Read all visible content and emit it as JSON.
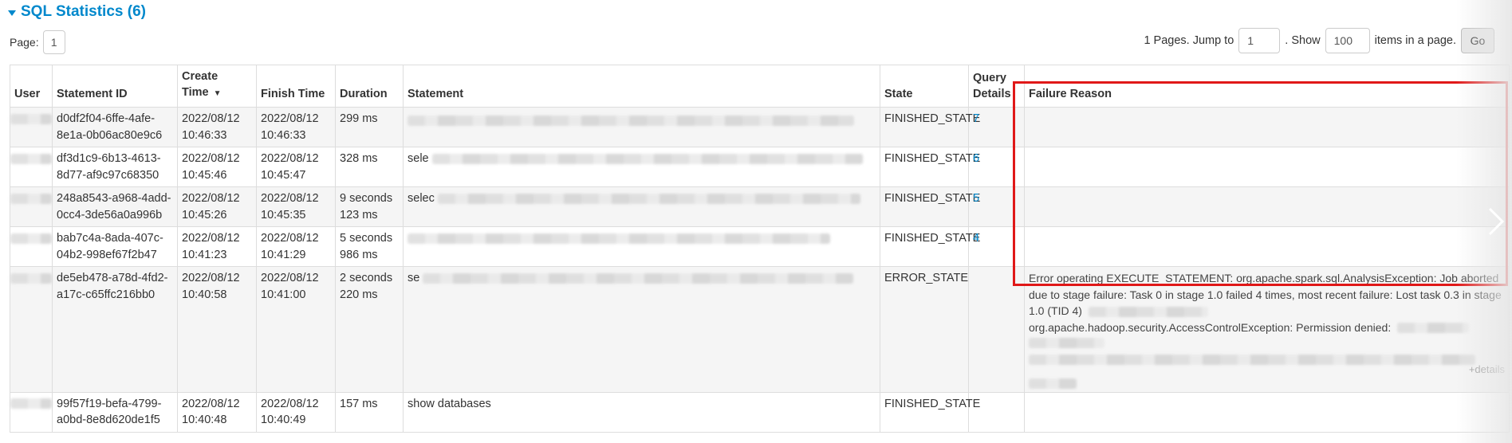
{
  "section": {
    "title": "SQL Statistics (6)"
  },
  "pager": {
    "page_label": "Page:",
    "current_page": "1",
    "pages_text": "1 Pages. Jump to",
    "jump_value": "1",
    "show_label": ". Show",
    "show_value": "100",
    "items_label": "items in a page.",
    "go_label": "Go"
  },
  "table": {
    "headers": {
      "user": "User",
      "statement_id": "Statement ID",
      "create_time": "Create Time",
      "finish_time": "Finish Time",
      "duration": "Duration",
      "statement": "Statement",
      "state": "State",
      "query_details": "Query Details",
      "failure_reason": "Failure Reason"
    },
    "rows": [
      {
        "statement_id": "d0df2f04-6ffe-4afe-8e1a-0b06ac80e9c6",
        "create_time": "2022/08/12 10:46:33",
        "finish_time": "2022/08/12 10:46:33",
        "duration": "299 ms",
        "statement": "",
        "state": "FINISHED_STATE",
        "query_details": "7",
        "failure_reason": ""
      },
      {
        "statement_id": "df3d1c9-6b13-4613-8d77-af9c97c68350",
        "create_time": "2022/08/12 10:45:46",
        "finish_time": "2022/08/12 10:45:47",
        "duration": "328 ms",
        "statement": "sele",
        "state": "FINISHED_STATE",
        "query_details": "6",
        "failure_reason": ""
      },
      {
        "statement_id": "248a8543-a968-4add-0cc4-3de56a0a996b",
        "create_time": "2022/08/12 10:45:26",
        "finish_time": "2022/08/12 10:45:35",
        "duration": "9 seconds 123 ms",
        "statement": "selec",
        "state": "FINISHED_STATE",
        "query_details": "5",
        "failure_reason": ""
      },
      {
        "statement_id": "bab7c4a-8ada-407c-04b2-998ef67f2b47",
        "create_time": "2022/08/12 10:41:23",
        "finish_time": "2022/08/12 10:41:29",
        "duration": "5 seconds 986 ms",
        "statement": "",
        "state": "FINISHED_STATE",
        "query_details": "4",
        "failure_reason": ""
      },
      {
        "statement_id": "de5eb478-a78d-4fd2-a17c-c65ffc216bb0",
        "create_time": "2022/08/12 10:40:58",
        "finish_time": "2022/08/12 10:41:00",
        "duration": "2 seconds 220 ms",
        "statement": "se",
        "state": "ERROR_STATE",
        "query_details": "",
        "failure_reason": "Error operating EXECUTE_STATEMENT: org.apache.spark.sql.AnalysisException: Job aborted due to stage failure: Task 0 in stage 1.0 failed 4 times, most recent failure: Lost task 0.3 in stage 1.0 (TID 4)",
        "failure_reason_2": "org.apache.hadoop.security.AccessControlException: Permission denied:",
        "details_label": "+details"
      },
      {
        "statement_id": "99f57f19-befa-4799-a0bd-8e8d620de1f5",
        "create_time": "2022/08/12 10:40:48",
        "finish_time": "2022/08/12 10:40:49",
        "duration": "157 ms",
        "statement": "show databases",
        "state": "FINISHED_STATE",
        "query_details": "",
        "failure_reason": ""
      }
    ]
  },
  "colors": {
    "link": "#0088cc",
    "highlight": "#e01818",
    "stripe": "#f5f5f5"
  },
  "icons": {
    "section_toggle": "caret-down-icon",
    "sort": "sort-desc-icon",
    "next": "chevron-right-icon"
  }
}
